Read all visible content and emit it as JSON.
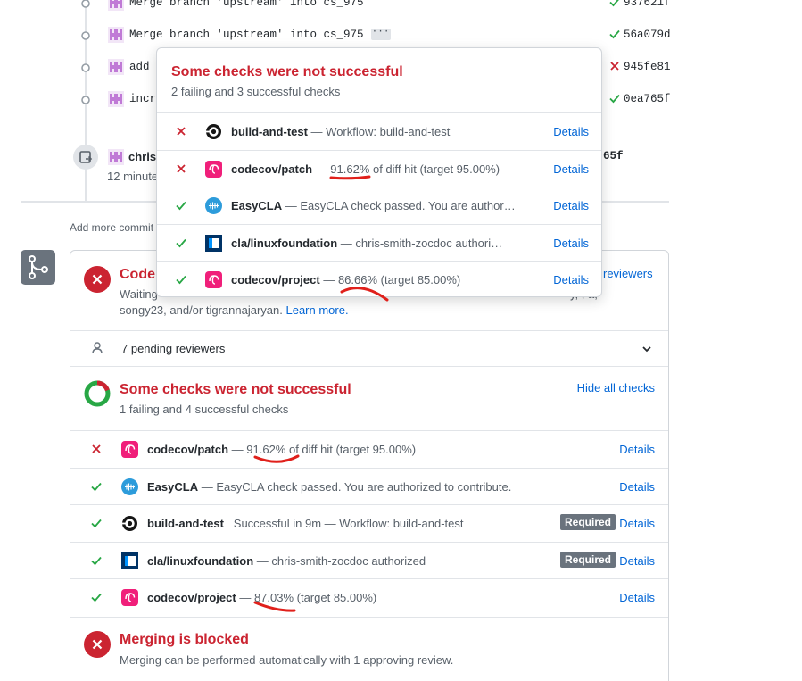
{
  "commits": [
    {
      "message": "Merge branch 'upstream' into cs_975",
      "sha": "937621f",
      "status": "success",
      "has_ellipsis": false
    },
    {
      "message": "Merge branch 'upstream' into cs_975",
      "sha": "56a079d",
      "status": "success",
      "has_ellipsis": true,
      "ellipsis": "···"
    },
    {
      "message": "add",
      "sha": "945fe81",
      "status": "failure",
      "has_ellipsis": false
    },
    {
      "message": "incr",
      "sha": "0ea765f",
      "status": "success",
      "has_ellipsis": false
    }
  ],
  "push_event": {
    "author": "chris",
    "time": "12 minute",
    "sha": "65f"
  },
  "add_more_commits": "Add more commit",
  "review": {
    "title": "Code",
    "text_line1": "Waiting",
    "text_line1_right": "y, , a,",
    "text_line2": "songy23, and/or tigrannajaryan.",
    "learn_more": "Learn more.",
    "reviewers_link": "reviewers"
  },
  "pending_reviewers": "7 pending reviewers",
  "checks_summary": {
    "title": "Some checks were not successful",
    "subtitle": "1 failing and 4 successful checks",
    "toggle": "Hide all checks"
  },
  "checks": [
    {
      "status": "failure",
      "app": "codecov-icon",
      "name": "codecov/patch",
      "sep": " — ",
      "desc": "91.62% of diff hit (target 95.00%)",
      "required": false
    },
    {
      "status": "success",
      "app": "easycla-icon",
      "name": "EasyCLA",
      "sep": " — ",
      "desc": "EasyCLA check passed. You are authorized to contribute.",
      "required": false
    },
    {
      "status": "success",
      "app": "circleci-icon",
      "name": "build-and-test",
      "sep": "   ",
      "desc": "Successful in 9m — Workflow: build-and-test",
      "required": true
    },
    {
      "status": "success",
      "app": "linuxfoundation-icon",
      "name": "cla/linuxfoundation",
      "sep": " — ",
      "desc": "chris-smith-zocdoc authorized",
      "required": true
    },
    {
      "status": "success",
      "app": "codecov-icon",
      "name": "codecov/project",
      "sep": " — ",
      "desc": "87.03% (target 85.00%)",
      "required": false
    }
  ],
  "required_label": "Required",
  "details_label": "Details",
  "merge_blocked": {
    "title": "Merging is blocked",
    "subtitle": "Merging can be performed automatically with 1 approving review."
  },
  "popover": {
    "title": "Some checks were not successful",
    "subtitle": "2 failing and 3 successful checks",
    "checks": [
      {
        "status": "failure",
        "app": "circleci-icon",
        "name": "build-and-test",
        "sep": " — ",
        "desc": "Workflow: build-and-test"
      },
      {
        "status": "failure",
        "app": "codecov-icon",
        "name": "codecov/patch",
        "sep": " — ",
        "desc": "91.62% of diff hit (target 95.00%)"
      },
      {
        "status": "success",
        "app": "easycla-icon",
        "name": "EasyCLA",
        "sep": " — ",
        "desc": "EasyCLA check passed. You are author…"
      },
      {
        "status": "success",
        "app": "linuxfoundation-icon",
        "name": "cla/linuxfoundation",
        "sep": " — ",
        "desc": "chris-smith-zocdoc authori…"
      },
      {
        "status": "success",
        "app": "codecov-icon",
        "name": "codecov/project",
        "sep": " — ",
        "desc": "86.66% (target 85.00%)"
      }
    ]
  },
  "colors": {
    "success": "#28a745",
    "failure": "#cb2431",
    "link": "#0366d6",
    "annotation": "#e0201b",
    "codecov": "#f01f7a",
    "easycla": "#2d9cdb"
  }
}
